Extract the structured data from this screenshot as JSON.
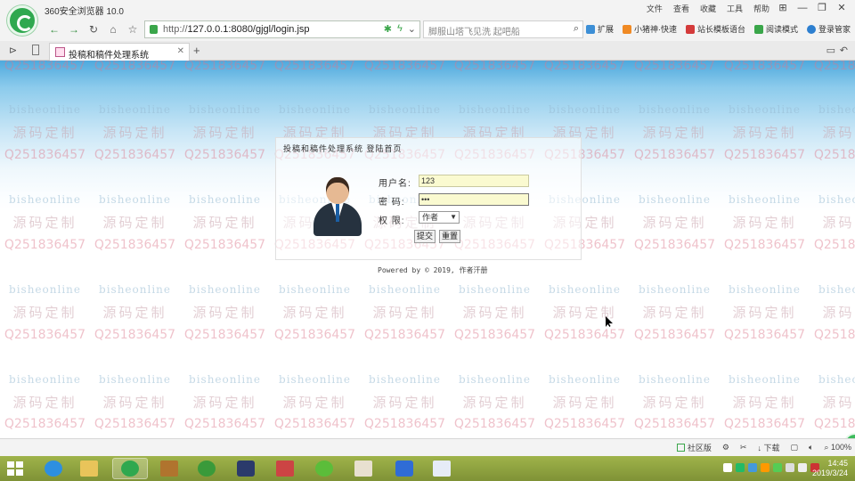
{
  "browser": {
    "app_title": "360安全浏览器 10.0",
    "menu": [
      "文件",
      "查看",
      "收藏",
      "工具",
      "帮助"
    ],
    "window_controls": [
      "⊞",
      "—",
      "❐",
      "✕"
    ],
    "url_prefix": "http://",
    "url": "127.0.0.1:8080/gjgl/login.jsp",
    "search_placeholder": "脚服山塔飞见洗  起吧船",
    "extensions": [
      "扩展",
      "小猪神·快速",
      "站长模板语台",
      "阅读模式",
      "登录管家"
    ],
    "tab_title": "投稿和稿件处理系统",
    "status_items": [
      "社区版",
      "下载",
      "100%"
    ]
  },
  "login": {
    "header": "投稿和稿件处理系统  登陆首页",
    "username_label": "用户名:",
    "username_value": "123",
    "password_label": "密  码:",
    "password_value": "•••",
    "role_label": "权  限:",
    "role_value": "作者",
    "submit_label": "提交",
    "reset_label": "重置",
    "footer": "Powered by © 2019, 作者汗册"
  },
  "watermarks": {
    "qq": "Q2518364​57",
    "site": "bisheonline",
    "cn": "源码定制"
  },
  "taskbar": {
    "time": "14:45",
    "date": "2019/3/24"
  },
  "colors": {
    "browser_green": "#2fa84f",
    "taskbar": "#8ca040",
    "input_bg": "#fafad0"
  }
}
